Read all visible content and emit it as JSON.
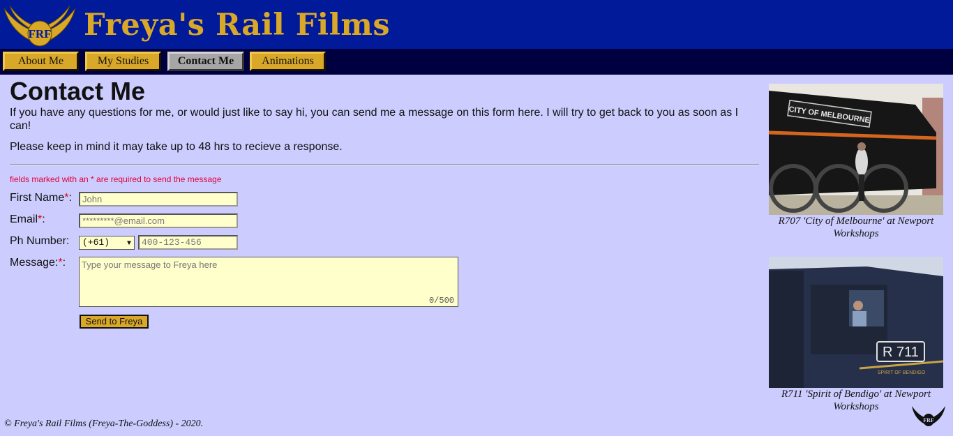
{
  "site": {
    "title": "Freya's Rail Films",
    "logo_text": "FRF"
  },
  "nav": [
    {
      "label": "About Me",
      "active": false
    },
    {
      "label": "My Studies",
      "active": false
    },
    {
      "label": "Contact Me",
      "active": true
    },
    {
      "label": "Animations",
      "active": false
    }
  ],
  "main": {
    "title": "Contact Me",
    "intro": "If you have any questions for me, or would just like to say hi, you can send me a message on this form here. I will try to get back to you as soon as I can!",
    "intro2": "Please keep in mind it may take up to 48 hrs to recieve a response.",
    "required_note": "fields marked with an * are required to send the message"
  },
  "form": {
    "first_name": {
      "label": "First Name",
      "required_mark": "*",
      "suffix": ":",
      "placeholder": "John"
    },
    "email": {
      "label": "Email",
      "required_mark": "*",
      "suffix": ":",
      "placeholder": "*********@email.com"
    },
    "phone": {
      "label": "Ph Number:",
      "country_code": "(+61)",
      "placeholder": "400-123-456"
    },
    "message": {
      "label": "Message:",
      "required_mark": "*",
      "suffix": ":",
      "placeholder": "Type your message to Freya here",
      "counter": "0/500"
    },
    "submit_label": "Send to Freya"
  },
  "sidebar": [
    {
      "caption": "R707 'City of Melbourne' at Newport Workshops",
      "plate": "CITY OF MELBOURNE"
    },
    {
      "caption": "R711 'Spirit of Bendigo' at Newport Workshops",
      "plate": "R 711",
      "band": "SPIRIT OF BENDIGO"
    }
  ],
  "footer": {
    "text": "© Freya's Rail Films (Freya-The-Goddess) - 2020."
  },
  "colors": {
    "header_bg": "#001a99",
    "nav_bg": "#000040",
    "gold": "#d9a829",
    "page_bg": "#ccccff",
    "field_bg": "#ffffcc",
    "required": "#e00000"
  }
}
